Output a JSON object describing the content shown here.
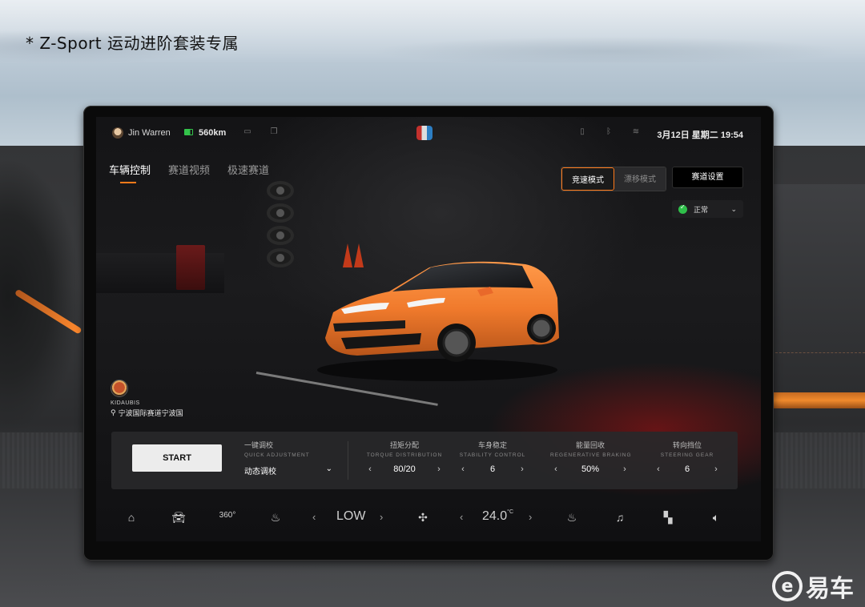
{
  "headline": "* Z-Sport 运动进阶套装专属",
  "watermark": {
    "logo": "e",
    "text": "易车"
  },
  "statusbar": {
    "user_name": "Jin Warren",
    "range": "560km",
    "datetime": "3月12日 星期二 19:54"
  },
  "tabs": [
    {
      "label": "车辆控制",
      "active": true
    },
    {
      "label": "赛道视频",
      "active": false
    },
    {
      "label": "极速赛道",
      "active": false
    }
  ],
  "modes": {
    "race": "竞速模式",
    "drift": "漂移模式",
    "track_settings": "赛道设置",
    "status": "正常"
  },
  "driver": {
    "name": "KIDAUBIS",
    "location": "宁波国际赛道宁波国"
  },
  "panel": {
    "start": "START",
    "quick_adjust": {
      "title": "一键调校",
      "subtitle": "QUICK ADJUSTMENT",
      "value": "动态调校"
    },
    "torque": {
      "title": "扭矩分配",
      "subtitle": "TORQUE DISTRIBUTION",
      "value": "80/20"
    },
    "stability": {
      "title": "车身稳定",
      "subtitle": "STABILITY CONTROL",
      "value": "6"
    },
    "regen": {
      "title": "能量回收",
      "subtitle": "REGENERATIVE BRAKING",
      "value": "50%"
    },
    "steering": {
      "title": "转向挡位",
      "subtitle": "STEERING GEAR",
      "value": "6"
    }
  },
  "dock": {
    "fan_level": "LOW",
    "temperature": "24.0",
    "temp_unit": "°C",
    "icons": [
      "car-home-icon",
      "car-icon",
      "camera-360-icon",
      "seat-heat-icon",
      "fan-icon",
      "seat-vent-icon",
      "music-icon",
      "apps-icon",
      "volume-icon"
    ]
  },
  "colors": {
    "accent": "#ff7a1a",
    "status_ok": "#2fbf4a",
    "car_body": "#f07a2c"
  }
}
